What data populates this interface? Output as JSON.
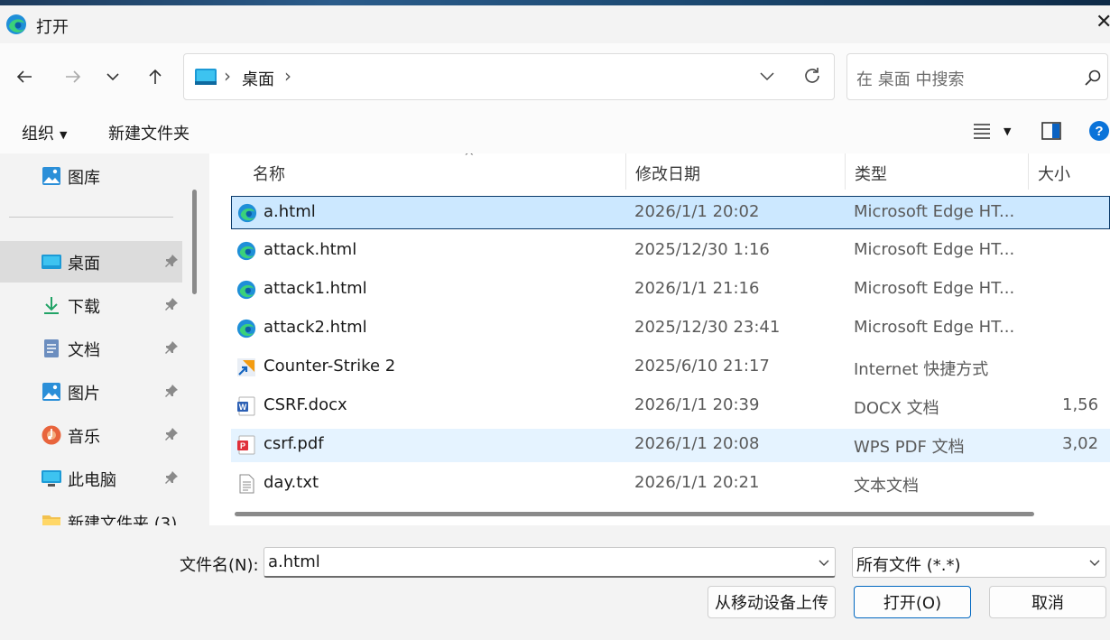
{
  "window": {
    "title": "打开"
  },
  "address": {
    "path": "桌面"
  },
  "search": {
    "placeholder": "在 桌面 中搜索"
  },
  "toolbar": {
    "organize": "组织",
    "new_folder": "新建文件夹"
  },
  "sidebar": {
    "items": [
      {
        "label": "图库"
      },
      {
        "label": "桌面"
      },
      {
        "label": "下载"
      },
      {
        "label": "文档"
      },
      {
        "label": "图片"
      },
      {
        "label": "音乐"
      },
      {
        "label": "此电脑"
      },
      {
        "label": "新建文件夹 (3)"
      }
    ]
  },
  "columns": {
    "name": "名称",
    "date": "修改日期",
    "type": "类型",
    "size": "大小"
  },
  "files": [
    {
      "name": "a.html",
      "date": "2026/1/1 20:02",
      "type": "Microsoft Edge HT...",
      "size": "",
      "icon": "edge-icon"
    },
    {
      "name": "attack.html",
      "date": "2025/12/30 1:16",
      "type": "Microsoft Edge HT...",
      "size": "",
      "icon": "edge-icon"
    },
    {
      "name": "attack1.html",
      "date": "2026/1/1 21:16",
      "type": "Microsoft Edge HT...",
      "size": "",
      "icon": "edge-icon"
    },
    {
      "name": "attack2.html",
      "date": "2025/12/30 23:41",
      "type": "Microsoft Edge HT...",
      "size": "",
      "icon": "edge-icon"
    },
    {
      "name": "Counter-Strike 2",
      "date": "2025/6/10 21:17",
      "type": "Internet 快捷方式",
      "size": "",
      "icon": "shortcut-icon"
    },
    {
      "name": "CSRF.docx",
      "date": "2026/1/1 20:39",
      "type": "DOCX 文档",
      "size": "1,56",
      "icon": "word-icon"
    },
    {
      "name": "csrf.pdf",
      "date": "2026/1/1 20:08",
      "type": "WPS PDF 文档",
      "size": "3,02",
      "icon": "pdf-icon"
    },
    {
      "name": "day.txt",
      "date": "2026/1/1 20:21",
      "type": "文本文档",
      "size": "",
      "icon": "text-file-icon"
    }
  ],
  "footer": {
    "filename_label": "文件名(N):",
    "filename_value": "a.html",
    "filetype_value": "所有文件 (*.*)",
    "upload_button": "从移动设备上传",
    "open_button": "打开(O)",
    "cancel_button": "取消"
  },
  "colors": {
    "selection": "#cce8ff",
    "accent": "#0067c0"
  }
}
